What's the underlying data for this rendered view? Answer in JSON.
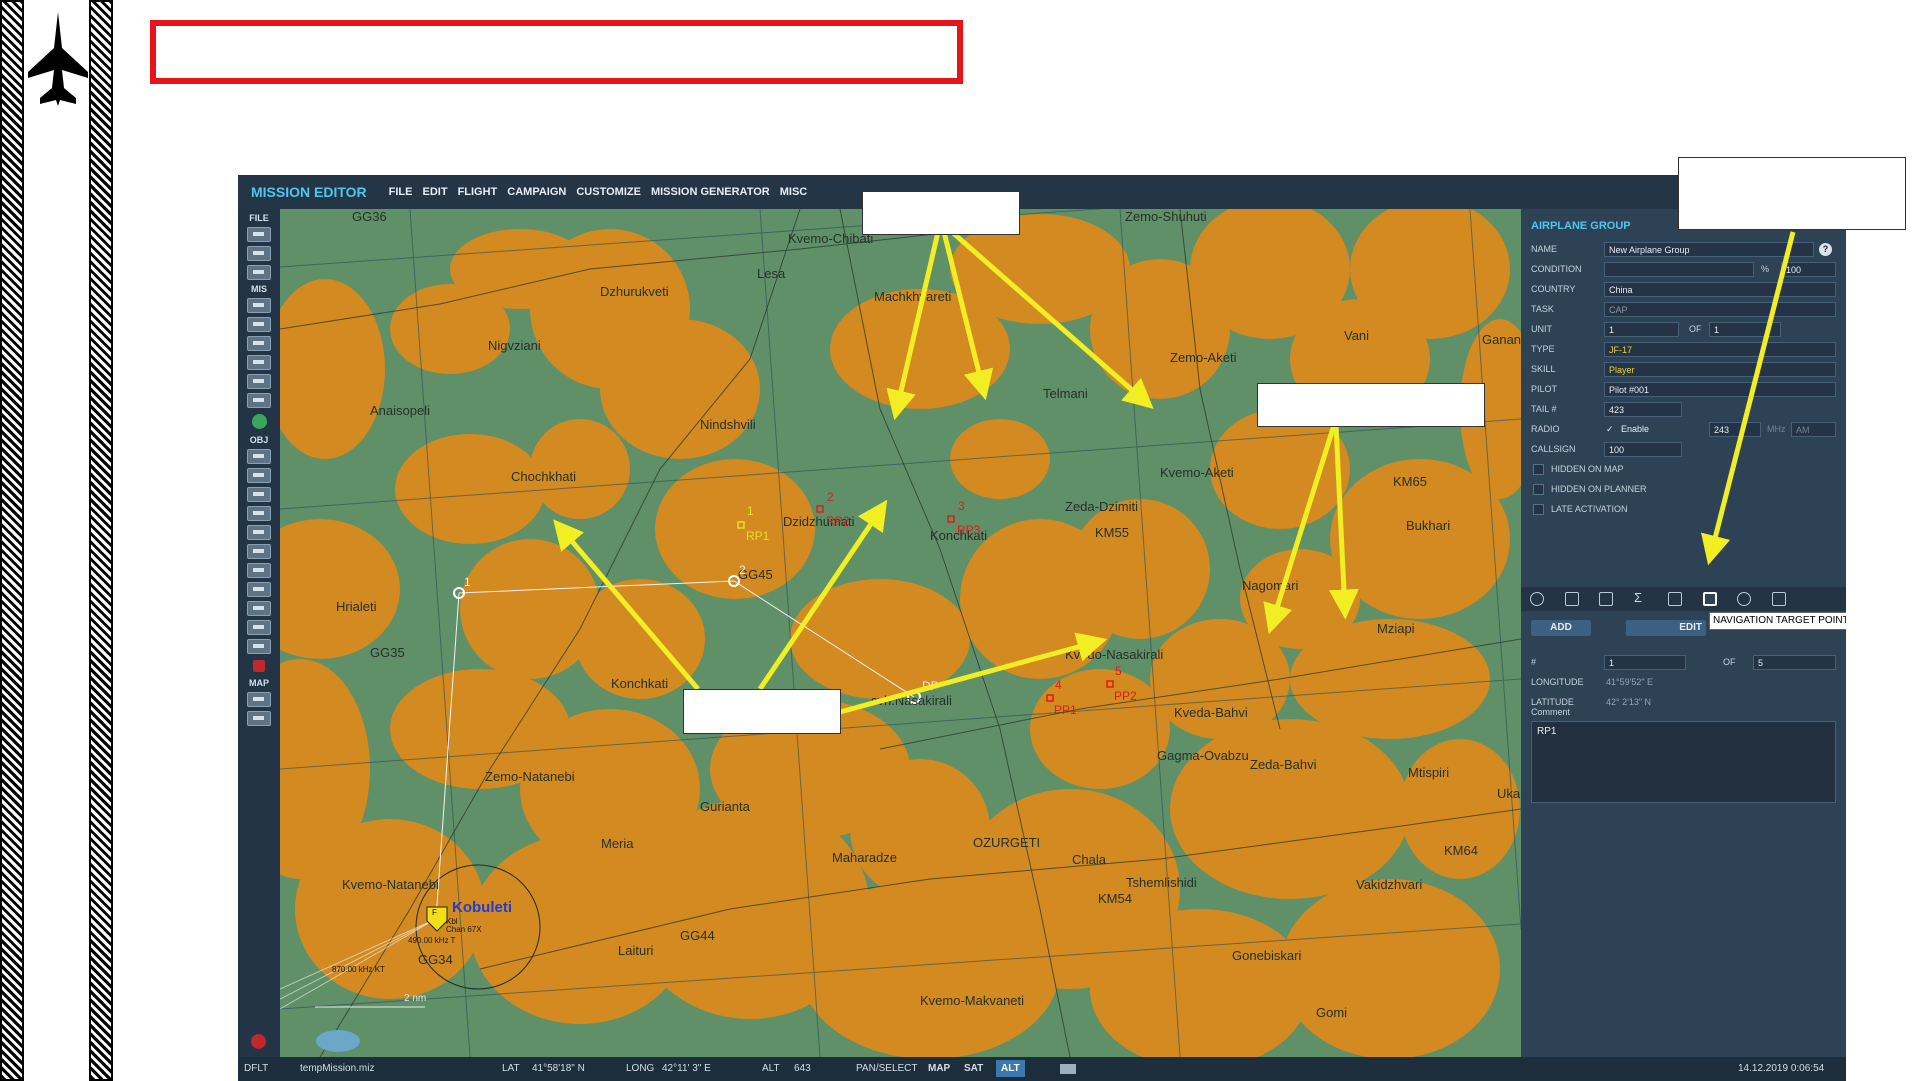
{
  "app": {
    "title": "MISSION EDITOR",
    "menu": [
      "FILE",
      "EDIT",
      "FLIGHT",
      "CAMPAIGN",
      "CUSTOMIZE",
      "MISSION GENERATOR",
      "MISC"
    ]
  },
  "toolbar": {
    "sections": [
      "FILE",
      "MIS",
      "OBJ",
      "MAP"
    ]
  },
  "map": {
    "grid_labels": [
      "GG36",
      "GG35",
      "GG45",
      "GG44",
      "GG34",
      "KM65",
      "KM55",
      "KM54",
      "KM64"
    ],
    "towns": [
      "Kvemo-Chibati",
      "Lesa",
      "Dzhurukveti",
      "Machkhvareti",
      "Zemo-Shuhuti",
      "Vani",
      "Ganan",
      "Zemo-Aketi",
      "Nigvziani",
      "Telmani",
      "Anaisopeli",
      "Nindshvili",
      "Chochkhati",
      "Kvemo-Aketi",
      "Zeda-Dzimiti",
      "Bukhari",
      "Dzidzhumati",
      "Konchkati",
      "Hrialeti",
      "Nagomari",
      "Mziapi",
      "Kvedo-Nasakirali",
      "Konchkati",
      "svh.Nasakirali",
      "Kveda-Bahvi",
      "Zemo-Natanebi",
      "Gagma-Ovabzu",
      "Zeda-Bahvi",
      "Mtispiri",
      "Gurianta",
      "Ukan",
      "Meria",
      "Maharadze",
      "OZURGETI",
      "Chala",
      "Kvemo-Natanebi",
      "Tshemlishidi",
      "Vakidzhvari",
      "Laituri",
      "Gonebiskari",
      "Gomi",
      "Kvemo-Makvaneti"
    ],
    "airfield": "Kobuleti",
    "airfield_info": [
      "Kbl",
      "Chan 67X"
    ],
    "freq_1": "490.00 kHz T",
    "freq_2": "870.00 kHz KT",
    "scale": "2 nm",
    "waypoints": [
      "1",
      "2",
      "DP"
    ],
    "airfield_marker": "F",
    "reference_points": [
      {
        "num": "1",
        "name": "RP1"
      },
      {
        "num": "2",
        "name": "RP2"
      },
      {
        "num": "3",
        "name": "RP3"
      },
      {
        "num": "4",
        "name": "PP1"
      },
      {
        "num": "5",
        "name": "PP2"
      }
    ]
  },
  "panel": {
    "title": "AIRPLANE GROUP",
    "help": "?",
    "name_label": "NAME",
    "name_value": "New Airplane Group",
    "condition_label": "CONDITION",
    "condition_pct": "%",
    "condition_value": "100",
    "country_label": "COUNTRY",
    "country_value": "China",
    "task_label": "TASK",
    "task_value": "CAP",
    "unit_label": "UNIT",
    "unit_value": "1",
    "of_label": "OF",
    "unit_of_value": "1",
    "type_label": "TYPE",
    "type_value": "JF-17",
    "skill_label": "SKILL",
    "skill_value": "Player",
    "pilot_label": "PILOT",
    "pilot_value": "Pilot #001",
    "tail_label": "TAIL #",
    "tail_value": "423",
    "radio_label": "RADIO",
    "radio_enable": "Enable",
    "radio_freq": "243",
    "radio_unit": "MHz",
    "radio_mod": "AM",
    "callsign_label": "CALLSIGN",
    "callsign_value": "100",
    "hidden_map": "HIDDEN ON MAP",
    "hidden_planner": "HIDDEN ON PLANNER",
    "late_activation": "LATE ACTIVATION",
    "add_btn": "ADD",
    "edit_btn": "EDIT",
    "tooltip": "NAVIGATION TARGET POINTS",
    "point_label": "#",
    "point_value": "1",
    "point_of": "OF",
    "point_total": "5",
    "longitude_label": "LONGITUDE",
    "longitude_value": "41°59'52\" E",
    "latitude_label": "LATITUDE",
    "latitude_value": "42° 2'13\" N",
    "comment_label": "Comment",
    "comment_value": "RP1"
  },
  "status": {
    "mode": "DFLT",
    "file": "tempMission.miz",
    "lat_label": "LAT",
    "lat_value": "41°58'18\" N",
    "long_label": "LONG",
    "long_value": "42°11' 3\" E",
    "alt_label": "ALT",
    "alt_value": "643",
    "pan_select": "PAN/SELECT",
    "map_btn": "MAP",
    "sat_btn": "SAT",
    "alt_btn": "ALT",
    "datetime": "14.12.2019 0:06:54"
  },
  "colors": {
    "accent": "#4fc6f0",
    "annotation": "#f2ee24",
    "highlight_box": "#e8141c",
    "terrain_green": "#5f9067",
    "terrain_orange": "#d98a1e",
    "waypoint_red": "#e11b1b"
  }
}
